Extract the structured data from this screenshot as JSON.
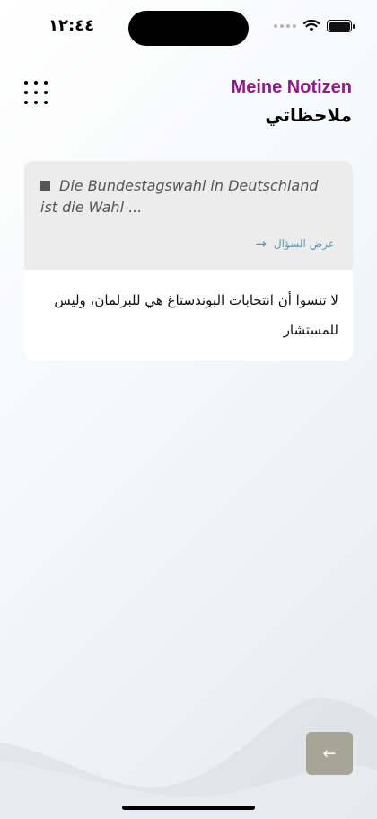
{
  "status_bar": {
    "time": "١٢:٤٤"
  },
  "header": {
    "title_en": "Meine Notizen",
    "title_ar": "ملاحظاتي"
  },
  "note": {
    "question": "Die Bundestagswahl in Deutschland ist die Wahl ...",
    "show_question_label": "عرض السؤال",
    "text": "لا تنسوا أن انتخابات البوندستاغ هي للبرلمان، وليس للمستشار"
  },
  "colors": {
    "title_accent": "#8e1b86",
    "link": "#5a9ab8",
    "back_button": "#a7a596"
  },
  "icons": {
    "menu": "grid-icon",
    "show_question": "arrow-right-icon",
    "back": "arrow-left-icon"
  }
}
